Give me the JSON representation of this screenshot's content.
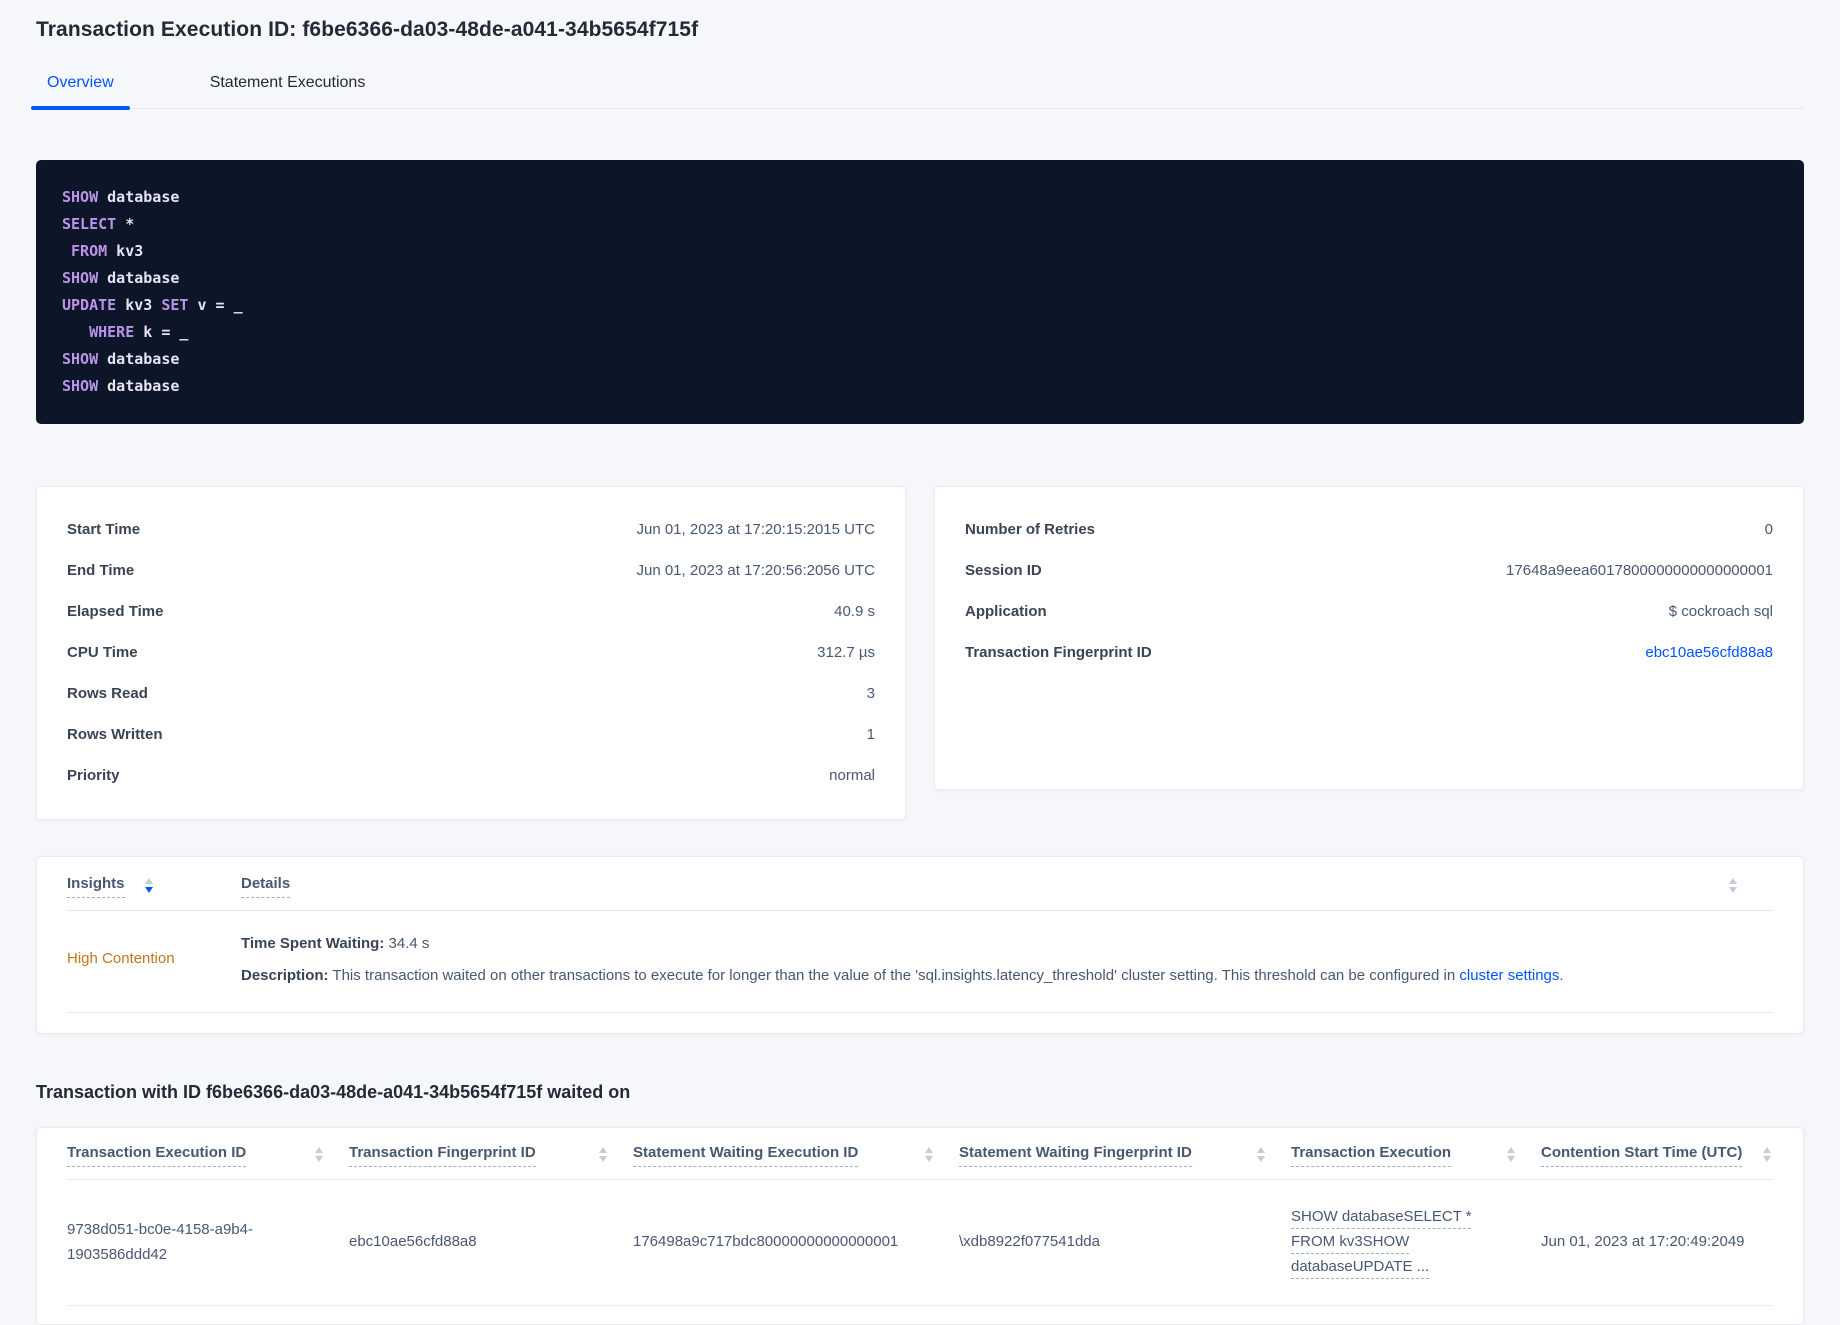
{
  "colors": {
    "accent_blue": "#0055ff",
    "insight_orange": "#c0771c",
    "sql_background": "#0d1628",
    "sql_keyword": "#bb93ea"
  },
  "header": {
    "title": "Transaction Execution ID: f6be6366-da03-48de-a041-34b5654f715f",
    "tabs": [
      {
        "label": "Overview"
      },
      {
        "label": "Statement Executions"
      }
    ]
  },
  "sql": {
    "lines": [
      {
        "tokens": [
          {
            "text": "SHOW",
            "kw": true
          },
          {
            "text": " database",
            "kw": false
          }
        ]
      },
      {
        "tokens": [
          {
            "text": "SELECT",
            "kw": true
          },
          {
            "text": " *",
            "kw": false
          }
        ]
      },
      {
        "tokens": [
          {
            "text": " ",
            "kw": false
          },
          {
            "text": "FROM",
            "kw": true
          },
          {
            "text": " kv3",
            "kw": false
          }
        ]
      },
      {
        "tokens": [
          {
            "text": "SHOW",
            "kw": true
          },
          {
            "text": " database",
            "kw": false
          }
        ]
      },
      {
        "tokens": [
          {
            "text": "UPDATE",
            "kw": true
          },
          {
            "text": " kv3 ",
            "kw": false
          },
          {
            "text": "SET",
            "kw": true
          },
          {
            "text": " v = _",
            "kw": false
          }
        ]
      },
      {
        "tokens": [
          {
            "text": "   ",
            "kw": false
          },
          {
            "text": "WHERE",
            "kw": true
          },
          {
            "text": " k = _",
            "kw": false
          }
        ]
      },
      {
        "tokens": [
          {
            "text": "SHOW",
            "kw": true
          },
          {
            "text": " database",
            "kw": false
          }
        ]
      },
      {
        "tokens": [
          {
            "text": "SHOW",
            "kw": true
          },
          {
            "text": " database",
            "kw": false
          }
        ]
      }
    ]
  },
  "stats_left": {
    "rows": [
      {
        "label": "Start Time",
        "value": "Jun 01, 2023 at 17:20:15:2015 UTC"
      },
      {
        "label": "End Time",
        "value": "Jun 01, 2023 at 17:20:56:2056 UTC"
      },
      {
        "label": "Elapsed Time",
        "value": "40.9 s"
      },
      {
        "label": "CPU Time",
        "value": "312.7 µs"
      },
      {
        "label": "Rows Read",
        "value": "3"
      },
      {
        "label": "Rows Written",
        "value": "1"
      },
      {
        "label": "Priority",
        "value": "normal"
      }
    ]
  },
  "stats_right": {
    "rows": [
      {
        "label": "Number of Retries",
        "value": "0"
      },
      {
        "label": "Session ID",
        "value": "17648a9eea6017800000000000000001"
      },
      {
        "label": "Application",
        "value": "$ cockroach sql"
      },
      {
        "label": "Transaction Fingerprint ID",
        "value": "ebc10ae56cfd88a8"
      }
    ]
  },
  "insights": {
    "columns": [
      {
        "label": "Insights"
      },
      {
        "label": "Details"
      }
    ],
    "sort": {
      "column": "Insights",
      "direction": "desc"
    },
    "row": {
      "insight": "High Contention",
      "waiting_label": "Time Spent Waiting:",
      "waiting_value": " 34.4 s",
      "description_label": "Description:",
      "description_text": " This transaction waited on other transactions to execute for longer than the value of the 'sql.insights.latency_threshold' cluster setting. This threshold can be configured in ",
      "description_link": "cluster settings",
      "description_suffix": "."
    }
  },
  "waited_on": {
    "heading": "Transaction with ID f6be6366-da03-48de-a041-34b5654f715f waited on",
    "columns": [
      {
        "label": "Transaction Execution ID"
      },
      {
        "label": "Transaction Fingerprint ID"
      },
      {
        "label": "Statement Waiting Execution ID"
      },
      {
        "label": "Statement Waiting Fingerprint ID"
      },
      {
        "label": "Transaction Execution"
      },
      {
        "label": "Contention Start Time (UTC)"
      }
    ],
    "row": {
      "transaction_execution_id": "9738d051-bc0e-4158-a9b4-1903586ddd42",
      "transaction_fingerprint_id": "ebc10ae56cfd88a8",
      "statement_waiting_execution_id": "176498a9c717bdc80000000000000001",
      "statement_waiting_fingerprint_id": "\\xdb8922f077541dda",
      "transaction_execution": "SHOW databaseSELECT * FROM kv3SHOW databaseUPDATE ...",
      "contention_start_time": "Jun 01, 2023 at 17:20:49:2049"
    }
  }
}
